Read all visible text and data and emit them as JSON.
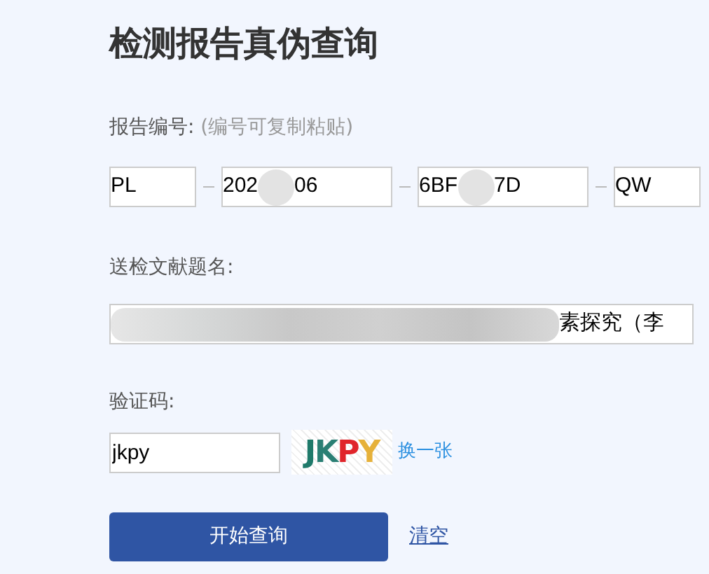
{
  "title": "检测报告真伪查询",
  "report_number": {
    "label": "报告编号:",
    "hint": "(编号可复制粘贴)",
    "parts": [
      {
        "before": "PL",
        "redacted": false
      },
      {
        "before": "202",
        "redacted": true,
        "after": "06"
      },
      {
        "before": "6BF",
        "redacted": true,
        "after": "7D"
      },
      {
        "before": "QW",
        "redacted": false
      }
    ]
  },
  "document_title": {
    "label": "送检文献题名:",
    "redacted": true,
    "after": "素探究（李"
  },
  "captcha": {
    "label": "验证码:",
    "value": "jkpy",
    "letters": [
      {
        "char": "J",
        "color": "#1f7a6a"
      },
      {
        "char": "K",
        "color": "#2a7f74"
      },
      {
        "char": "P",
        "color": "#e0242a"
      },
      {
        "char": "Y",
        "color": "#e6b13a"
      }
    ],
    "refresh": "换一张"
  },
  "buttons": {
    "submit": "开始查询",
    "clear": "清空"
  }
}
